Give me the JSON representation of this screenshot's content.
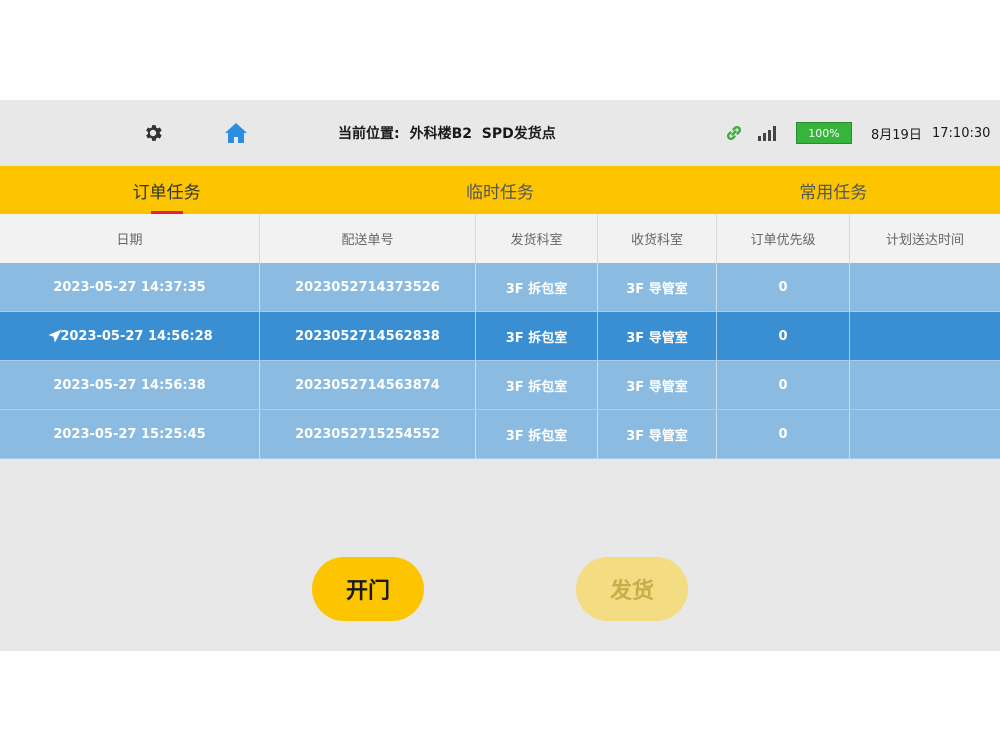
{
  "statusbar": {
    "icons": [
      "gear-icon",
      "home-icon",
      "link-icon",
      "signal-icon"
    ],
    "location_label": "当前位置:",
    "location_value": "外科楼B2  SPD发货点",
    "battery": "100%",
    "date": "8月19日",
    "time": "17:10:30",
    "colors": {
      "home": "#2d8ee0",
      "link": "#3cae3a",
      "battery": "#35b53a"
    }
  },
  "tabs": [
    {
      "label": "订单任务",
      "active": true
    },
    {
      "label": "临时任务",
      "active": false
    },
    {
      "label": "常用任务",
      "active": false
    }
  ],
  "table": {
    "columns": [
      "日期",
      "配送单号",
      "发货科室",
      "收货科室",
      "订单优先级",
      "计划送达时间"
    ],
    "rows": [
      {
        "date": "2023-05-27 14:37:35",
        "order_no": "2023052714373526",
        "from": "3F 拆包室",
        "to": "3F 导管室",
        "priority": "0",
        "planned": "",
        "selected": false
      },
      {
        "date": "2023-05-27 14:56:28",
        "order_no": "2023052714562838",
        "from": "3F 拆包室",
        "to": "3F 导管室",
        "priority": "0",
        "planned": "",
        "selected": true,
        "icon": "send-icon"
      },
      {
        "date": "2023-05-27 14:56:38",
        "order_no": "2023052714563874",
        "from": "3F 拆包室",
        "to": "3F 导管室",
        "priority": "0",
        "planned": "",
        "selected": false
      },
      {
        "date": "2023-05-27 15:25:45",
        "order_no": "2023052715254552",
        "from": "3F 拆包室",
        "to": "3F 导管室",
        "priority": "0",
        "planned": "",
        "selected": false
      }
    ]
  },
  "buttons": {
    "open_door": "开门",
    "ship": "发货"
  },
  "colors": {
    "accent": "#fcc500",
    "row": "#8bbbe0",
    "row_selected": "#3a8fd3",
    "tab_indicator": "#e3262c"
  }
}
